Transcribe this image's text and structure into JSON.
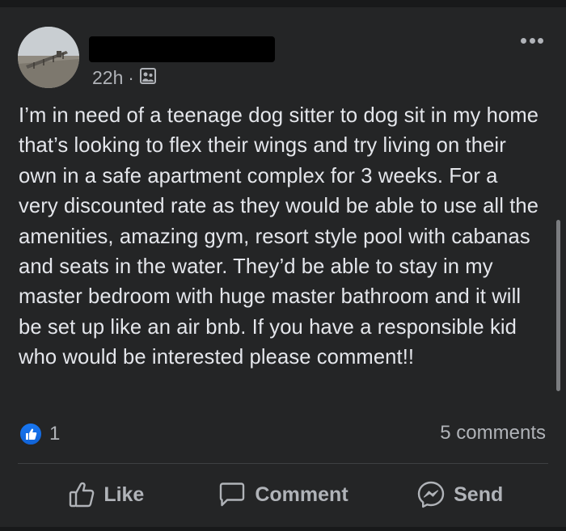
{
  "post": {
    "author_name": "",
    "timestamp": "22h",
    "separator": "·",
    "audience_icon": "friends-icon",
    "body": "I’m in need of a teenage dog sitter to dog sit in my home that’s looking to flex their wings and try living on their own in a safe apartment complex for 3 weeks. For a very discounted rate as they would be able to use all the amenities, amazing gym, resort style pool with cabanas and seats in the water. They’d be able to stay in my master bedroom with huge master bathroom and it will be set up like an air bnb. If you have a responsible kid who would be interested please comment!!"
  },
  "reactions": {
    "icon": "like-icon",
    "count": "1",
    "comments": "5 comments"
  },
  "actions": {
    "like": "Like",
    "comment": "Comment",
    "send": "Send"
  },
  "colors": {
    "background": "#242526",
    "text": "#e4e6eb",
    "secondary": "#b0b3b8",
    "accent": "#1877f2"
  }
}
